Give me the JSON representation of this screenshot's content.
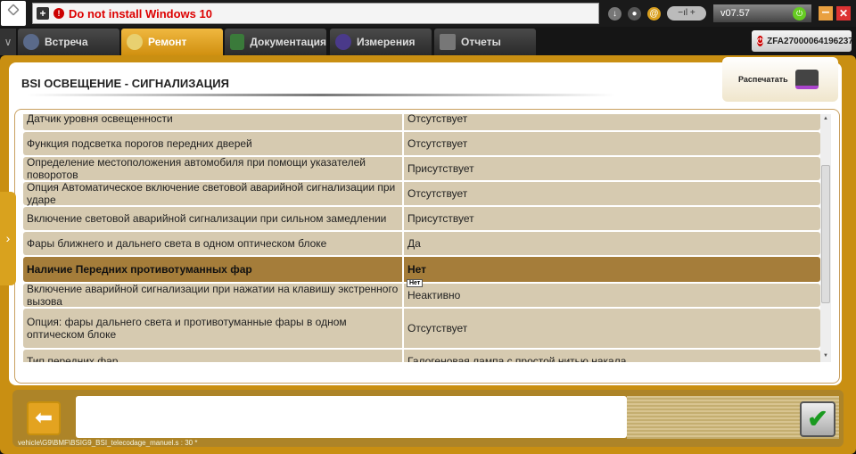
{
  "topbar": {
    "message": "Do not install Windows 10",
    "version": "v07.57",
    "logo_text": "CITROËN"
  },
  "tabs": [
    {
      "label": "Встреча"
    },
    {
      "label": "Ремонт",
      "active": true
    },
    {
      "label": "Документация"
    },
    {
      "label": "Измерения"
    },
    {
      "label": "Отчеты"
    }
  ],
  "vin": "ZFA27000064196237",
  "page": {
    "title": "BSI  ОСВЕЩЕНИЕ - СИГНАЛИЗАЦИЯ",
    "print_label": "Распечатать"
  },
  "rows": [
    {
      "param": "Датчик уровня освещенности",
      "value": "Отсутствует"
    },
    {
      "param": "Функция подсветка порогов передних дверей",
      "value": "Отсутствует"
    },
    {
      "param": "Определение местоположения автомобиля при помощи указателей поворотов",
      "value": "Присутствует"
    },
    {
      "param": "Опция Автоматическое включение световой аварийной сигнализации при ударе",
      "value": "Отсутствует"
    },
    {
      "param": "Включение световой аварийной сигнализации при сильном замедлении",
      "value": "Присутствует"
    },
    {
      "param": "Фары ближнего и дальнего света в одном оптическом блоке",
      "value": "Да"
    },
    {
      "param": "Наличие Передних противотуманных фар",
      "value": "Нет",
      "selected": true
    },
    {
      "param": "Включение аварийной сигнализации при нажатии на клавишу экстренного вызова",
      "value": "Неактивно"
    },
    {
      "param": "Опция: фары дальнего света и противотуманные фары в одном оптическом блоке",
      "value": "Отсутствует"
    },
    {
      "param": "Тип передних фар",
      "value": "Галогеновая лампа с простой нитью накала"
    }
  ],
  "tooltip": "Нет",
  "status": "vehicle\\G9\\BMF\\BSIG9_BSI_telecodage_manuel.s : 30 *",
  "colors": {
    "frame": "#c98f12",
    "row": "#d6cab0",
    "selected_row": "#a57d3a",
    "message": "#dd0000"
  }
}
